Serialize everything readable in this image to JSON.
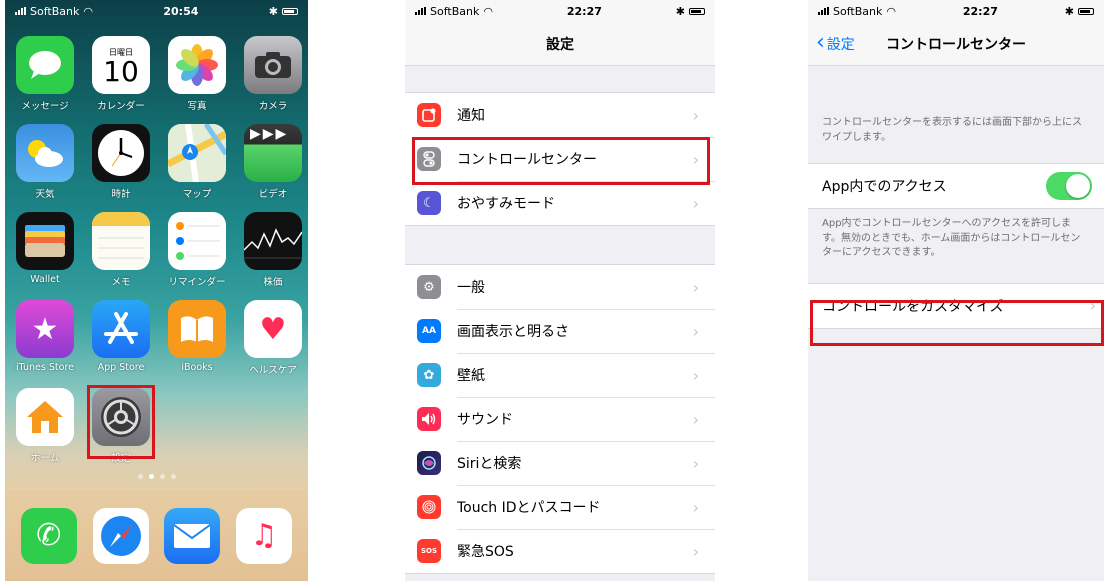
{
  "home": {
    "status": {
      "carrier": "SoftBank",
      "time": "20:54"
    },
    "apps": [
      {
        "label": "メッセージ",
        "icon": "messages-icon",
        "color": "#2fcd4c"
      },
      {
        "label": "カレンダー",
        "icon": "calendar-icon",
        "color": "#ffffff",
        "weekday": "日曜日",
        "day": "10"
      },
      {
        "label": "写真",
        "icon": "photos-icon",
        "color": "#ffffff"
      },
      {
        "label": "カメラ",
        "icon": "camera-icon",
        "color": "#8e8e93"
      },
      {
        "label": "天気",
        "icon": "weather-icon",
        "color": "#3d9bea"
      },
      {
        "label": "時計",
        "icon": "clock-icon",
        "color": "#111111"
      },
      {
        "label": "マップ",
        "icon": "maps-icon",
        "color": "#8fd08a"
      },
      {
        "label": "ビデオ",
        "icon": "videos-icon",
        "color": "#2a2a2a"
      },
      {
        "label": "Wallet",
        "icon": "wallet-icon",
        "color": "#111111"
      },
      {
        "label": "メモ",
        "icon": "notes-icon",
        "color": "#fcfcf4"
      },
      {
        "label": "リマインダー",
        "icon": "reminders-icon",
        "color": "#ffffff"
      },
      {
        "label": "株価",
        "icon": "stocks-icon",
        "color": "#111111"
      },
      {
        "label": "iTunes Store",
        "icon": "itunes-store-icon",
        "color": "#b83cd6"
      },
      {
        "label": "App Store",
        "icon": "app-store-icon",
        "color": "#1b86f2"
      },
      {
        "label": "iBooks",
        "icon": "ibooks-icon",
        "color": "#f79a1c"
      },
      {
        "label": "ヘルスケア",
        "icon": "health-icon",
        "color": "#ffffff"
      },
      {
        "label": "ホーム",
        "icon": "home-app-icon",
        "color": "#ffffff"
      },
      {
        "label": "設定",
        "icon": "settings-icon",
        "color": "#8e8e93"
      }
    ],
    "dock": [
      {
        "icon": "phone-icon",
        "color": "#2fcd4c"
      },
      {
        "icon": "safari-icon",
        "color": "#ffffff"
      },
      {
        "icon": "mail-icon",
        "color": "#1b86f2"
      },
      {
        "icon": "music-icon",
        "color": "#ffffff"
      }
    ]
  },
  "settings": {
    "status": {
      "carrier": "SoftBank",
      "time": "22:27"
    },
    "title": "設定",
    "group1": [
      {
        "label": "通知",
        "icon": "notifications-icon",
        "color": "#ff3b30"
      },
      {
        "label": "コントロールセンター",
        "icon": "control-center-icon",
        "color": "#8e8e93"
      },
      {
        "label": "おやすみモード",
        "icon": "moon-icon",
        "color": "#5856d6"
      }
    ],
    "group2": [
      {
        "label": "一般",
        "icon": "gear-icon",
        "color": "#8e8e93"
      },
      {
        "label": "画面表示と明るさ",
        "icon": "display-icon",
        "color": "#007aff",
        "glyph": "AA"
      },
      {
        "label": "壁紙",
        "icon": "wallpaper-icon",
        "color": "#34aadc"
      },
      {
        "label": "サウンド",
        "icon": "sounds-icon",
        "color": "#ff2d55"
      },
      {
        "label": "Siriと検索",
        "icon": "siri-icon",
        "color": "#1c1c4a"
      },
      {
        "label": "Touch IDとパスコード",
        "icon": "touch-id-icon",
        "color": "#ff3b30"
      },
      {
        "label": "緊急SOS",
        "icon": "sos-icon",
        "color": "#ff3b30",
        "glyph": "SOS"
      }
    ]
  },
  "control": {
    "status": {
      "carrier": "SoftBank",
      "time": "22:27"
    },
    "back_label": "設定",
    "title": "コントロールセンター",
    "description": "コントロールセンターを表示するには画面下部から上にスワイプします。",
    "access_label": "App内でのアクセス",
    "access_on": true,
    "access_desc": "App内でコントロールセンターへのアクセスを許可します。無効のときでも、ホーム画面からはコントロールセンターにアクセスできます。",
    "customize_label": "コントロールをカスタマイズ"
  },
  "colors": {
    "highlight": "#d8141c",
    "toggle_on": "#4cd964",
    "link": "#007aff"
  }
}
